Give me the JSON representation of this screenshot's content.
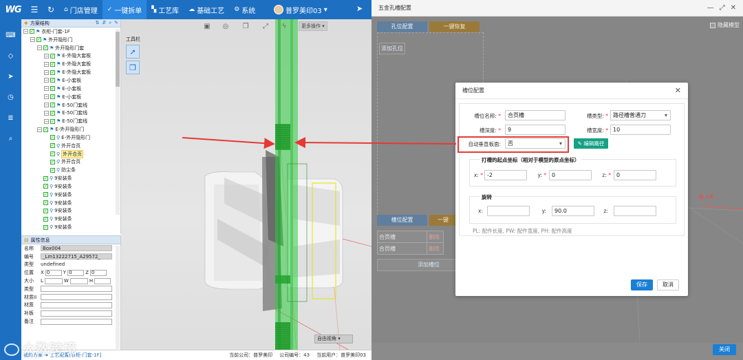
{
  "nav": {
    "logo": "WG",
    "items": [
      {
        "label": "门店管理",
        "icon": "⌂"
      },
      {
        "label": "一键拆单",
        "icon": "✓",
        "active": true
      },
      {
        "label": "工艺库",
        "icon": "▚"
      },
      {
        "label": "基础工艺",
        "icon": "☁"
      },
      {
        "label": "系统",
        "icon": "⚙"
      }
    ],
    "user": "普罗美印03"
  },
  "tree": {
    "header": "方案结构",
    "rows": [
      {
        "indent": 0,
        "label": "衣柜-门套-1F",
        "exp": true
      },
      {
        "indent": 1,
        "label": "外开隐形门",
        "exp": true
      },
      {
        "indent": 2,
        "label": "外开隐形门套",
        "exp": true
      },
      {
        "indent": 3,
        "label": "E-外隐大套板",
        "exp": true
      },
      {
        "indent": 3,
        "label": "E-外隐大套板",
        "exp": true
      },
      {
        "indent": 3,
        "label": "E-外隐大套板",
        "exp": true
      },
      {
        "indent": 3,
        "label": "E-小套板",
        "exp": true
      },
      {
        "indent": 3,
        "label": "E-小套板",
        "exp": true
      },
      {
        "indent": 3,
        "label": "E-小套板",
        "exp": true
      },
      {
        "indent": 3,
        "label": "E-50门套线",
        "exp": true
      },
      {
        "indent": 3,
        "label": "E-50门套线",
        "exp": true
      },
      {
        "indent": 3,
        "label": "E-50门套线",
        "exp": true
      },
      {
        "indent": 2,
        "label": "E-外开隐形门",
        "exp": true
      },
      {
        "indent": 3,
        "label": "E-外开隐形门",
        "exp": false
      },
      {
        "indent": 3,
        "label": "外开合页",
        "exp": false
      },
      {
        "indent": 3,
        "label": "外开合页",
        "exp": false,
        "selected": true
      },
      {
        "indent": 3,
        "label": "外开合页",
        "exp": false
      },
      {
        "indent": 3,
        "label": "防尘条",
        "exp": false
      },
      {
        "indent": 2,
        "label": "9安装条",
        "exp": false
      },
      {
        "indent": 2,
        "label": "9安装条",
        "exp": false
      },
      {
        "indent": 2,
        "label": "9安装条",
        "exp": false
      },
      {
        "indent": 2,
        "label": "9安装条",
        "exp": false
      },
      {
        "indent": 2,
        "label": "9安装条",
        "exp": false
      },
      {
        "indent": 2,
        "label": "9安装条",
        "exp": false
      },
      {
        "indent": 2,
        "label": "9安装条",
        "exp": false
      }
    ]
  },
  "props": {
    "header": "属性信息",
    "name_label": "名称",
    "name_value": "Box004",
    "code_label": "编号",
    "code_value": "_Lm13222715_A29572_",
    "type_label": "类型",
    "type_value": "undefined",
    "pos_label": "位置",
    "pos_x": "0",
    "pos_y": "0",
    "pos_z": "0",
    "size_label": "大小",
    "size_l": "L",
    "size_w": "W",
    "size_h": "H",
    "kind_label": "类型",
    "mat1_label": "材质II",
    "mat2_label": "材质",
    "patch_label": "补板",
    "note_label": "备注"
  },
  "viewport": {
    "more_ops": "更多操作",
    "toolbox_title": "工具栏",
    "view_select": "自由视角"
  },
  "status": {
    "crumb_prefix": "我的方案",
    "crumb_arrow": "➜",
    "crumb_path": "工艺配置[衣柜-门套-1F]",
    "company": "当前公司：普罗美印",
    "company_no": "公司编号：43",
    "current_user": "当前用户：普罗美印03"
  },
  "watermark": "大数跨境",
  "hw_window": {
    "title": "五金孔槽配置",
    "tab_hole": "孔位配置",
    "btn_restore": "一键恢复",
    "add_hole": "添加孔位",
    "tab_slot": "槽位配置",
    "btn_restore2": "一键",
    "hide_model": "隐藏模型",
    "slot_rows": [
      {
        "name": "合页槽",
        "action": "删除"
      },
      {
        "name": "合页槽",
        "action": "删除"
      }
    ],
    "add_slot": "添加槽位",
    "close_btn": "关闭",
    "axis_label": "右 +X"
  },
  "dialog": {
    "title": "槽位配置",
    "slot_name_label": "槽位名称:",
    "slot_name_value": "合页槽",
    "slot_type_label": "槽类型:",
    "slot_type_value": "路径槽普通刀",
    "slot_depth_label": "槽深度:",
    "slot_depth_value": "9",
    "slot_width_label": "槽宽度:",
    "slot_width_value": "10",
    "auto_vertical_label": "自动垂直板面:",
    "auto_vertical_value": "否",
    "edit_path": "编辑路径",
    "start_title": "打槽的起点坐标（相对于模型的原点坐标）",
    "x_label": "x:",
    "x_value": "-2",
    "y_label": "y:",
    "y_value": "0",
    "z_label": "z:",
    "z_value": "0",
    "rot_title": "旋转",
    "rx_label": "x:",
    "rx_value": "",
    "ry_label": "y:",
    "ry_value": "90.0",
    "rz_label": "z:",
    "rz_value": "",
    "hint": "PL: 配件长度, PW: 配件宽度, PH: 配件高度",
    "save": "保存",
    "cancel": "取消"
  }
}
